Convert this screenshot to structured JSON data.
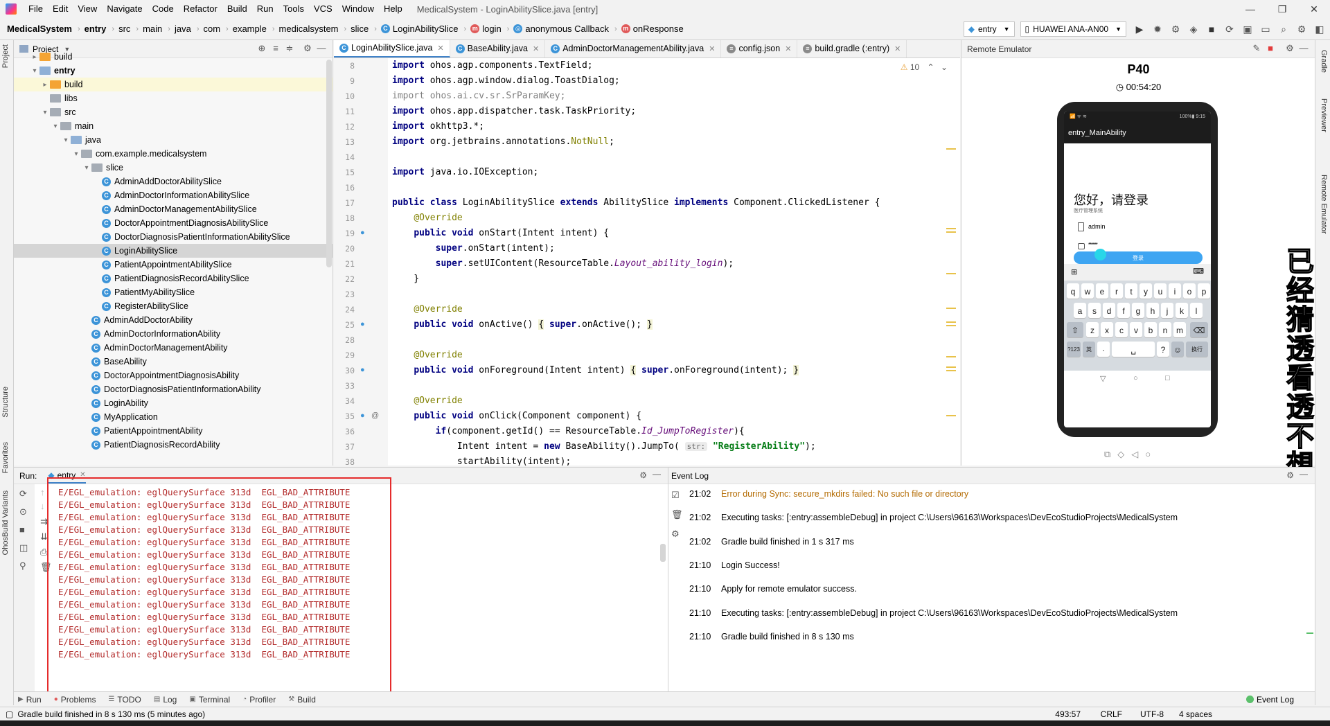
{
  "menubar": {
    "items": [
      "File",
      "Edit",
      "View",
      "Navigate",
      "Code",
      "Refactor",
      "Build",
      "Run",
      "Tools",
      "VCS",
      "Window",
      "Help"
    ],
    "title": "MedicalSystem - LoginAbilitySlice.java [entry]"
  },
  "navbar": {
    "crumbs": [
      "MedicalSystem",
      "entry",
      "src",
      "main",
      "java",
      "com",
      "example",
      "medicalsystem",
      "slice",
      "LoginAbilitySlice",
      "login",
      "anonymous Callback",
      "onResponse"
    ],
    "config": "entry",
    "device": "HUAWEI ANA-AN00"
  },
  "project": {
    "title": "Project",
    "tree": [
      {
        "label": "build",
        "depth": 1,
        "type": "folder-orange",
        "arrow": "▸"
      },
      {
        "label": "entry",
        "depth": 1,
        "type": "folder-blue",
        "arrow": "▾",
        "bold": true
      },
      {
        "label": "build",
        "depth": 2,
        "type": "folder-orange",
        "arrow": "▸",
        "hl": true
      },
      {
        "label": "libs",
        "depth": 2,
        "type": "folder-grey",
        "arrow": ""
      },
      {
        "label": "src",
        "depth": 2,
        "type": "folder-grey",
        "arrow": "▾"
      },
      {
        "label": "main",
        "depth": 3,
        "type": "folder-grey",
        "arrow": "▾"
      },
      {
        "label": "java",
        "depth": 4,
        "type": "folder-blue",
        "arrow": "▾"
      },
      {
        "label": "com.example.medicalsystem",
        "depth": 5,
        "type": "folder-grey",
        "arrow": "▾"
      },
      {
        "label": "slice",
        "depth": 6,
        "type": "folder-grey",
        "arrow": "▾"
      },
      {
        "label": "AdminAddDoctorAbilitySlice",
        "depth": 7,
        "type": "class",
        "arrow": ""
      },
      {
        "label": "AdminDoctorInformationAbilitySlice",
        "depth": 7,
        "type": "class",
        "arrow": ""
      },
      {
        "label": "AdminDoctorManagementAbilitySlice",
        "depth": 7,
        "type": "class",
        "arrow": ""
      },
      {
        "label": "DoctorAppointmentDiagnosisAbilitySlice",
        "depth": 7,
        "type": "class",
        "arrow": ""
      },
      {
        "label": "DoctorDiagnosisPatientInformationAbilitySlice",
        "depth": 7,
        "type": "class",
        "arrow": ""
      },
      {
        "label": "LoginAbilitySlice",
        "depth": 7,
        "type": "class",
        "arrow": "",
        "sel": true
      },
      {
        "label": "PatientAppointmentAbilitySlice",
        "depth": 7,
        "type": "class",
        "arrow": ""
      },
      {
        "label": "PatientDiagnosisRecordAbilitySlice",
        "depth": 7,
        "type": "class",
        "arrow": ""
      },
      {
        "label": "PatientMyAbilitySlice",
        "depth": 7,
        "type": "class",
        "arrow": ""
      },
      {
        "label": "RegisterAbilitySlice",
        "depth": 7,
        "type": "class",
        "arrow": ""
      },
      {
        "label": "AdminAddDoctorAbility",
        "depth": 6,
        "type": "class",
        "arrow": ""
      },
      {
        "label": "AdminDoctorInformationAbility",
        "depth": 6,
        "type": "class",
        "arrow": ""
      },
      {
        "label": "AdminDoctorManagementAbility",
        "depth": 6,
        "type": "class",
        "arrow": ""
      },
      {
        "label": "BaseAbility",
        "depth": 6,
        "type": "class",
        "arrow": ""
      },
      {
        "label": "DoctorAppointmentDiagnosisAbility",
        "depth": 6,
        "type": "class",
        "arrow": ""
      },
      {
        "label": "DoctorDiagnosisPatientInformationAbility",
        "depth": 6,
        "type": "class",
        "arrow": ""
      },
      {
        "label": "LoginAbility",
        "depth": 6,
        "type": "class",
        "arrow": ""
      },
      {
        "label": "MyApplication",
        "depth": 6,
        "type": "class",
        "arrow": ""
      },
      {
        "label": "PatientAppointmentAbility",
        "depth": 6,
        "type": "class",
        "arrow": ""
      },
      {
        "label": "PatientDiagnosisRecordAbility",
        "depth": 6,
        "type": "class",
        "arrow": ""
      }
    ]
  },
  "editor": {
    "tabs": [
      "LoginAbilitySlice.java",
      "BaseAbility.java",
      "AdminDoctorManagementAbility.java",
      "config.json",
      "build.gradle (:entry)"
    ],
    "warnings": "10",
    "line_numbers": [
      "8",
      "9",
      "10",
      "11",
      "12",
      "13",
      "14",
      "15",
      "16",
      "17",
      "18",
      "19",
      "20",
      "21",
      "22",
      "23",
      "24",
      "25",
      "28",
      "29",
      "30",
      "33",
      "34",
      "35",
      "36",
      "37",
      "38"
    ]
  },
  "emulator": {
    "title": "Remote Emulator",
    "device": "P40",
    "timer": "00:54:20",
    "app_title": "entry_MainAbility",
    "greeting": "您好，请登录",
    "subtitle": "医疗管理系统",
    "username": "admin",
    "password": "******",
    "login_button": "登录",
    "status_left": "📶 ᯤ ≋",
    "status_right": "100%▮ 9:15",
    "kb_row1": [
      "q",
      "w",
      "e",
      "r",
      "t",
      "y",
      "u",
      "i",
      "o",
      "p"
    ],
    "kb_row2": [
      "a",
      "s",
      "d",
      "f",
      "g",
      "h",
      "j",
      "k",
      "l"
    ],
    "kb_row3": [
      "z",
      "x",
      "c",
      "v",
      "b",
      "n",
      "m"
    ],
    "kb_123": "?123",
    "kb_lang": "英",
    "kb_enter": "换行"
  },
  "watermark": "已经猜透看透不想多说",
  "run": {
    "label": "Run:",
    "tab": "entry",
    "lines": [
      "E/EGL_emulation: eglQuerySurface 313d  EGL_BAD_ATTRIBUTE",
      "E/EGL_emulation: eglQuerySurface 313d  EGL_BAD_ATTRIBUTE",
      "E/EGL_emulation: eglQuerySurface 313d  EGL_BAD_ATTRIBUTE",
      "E/EGL_emulation: eglQuerySurface 313d  EGL_BAD_ATTRIBUTE",
      "E/EGL_emulation: eglQuerySurface 313d  EGL_BAD_ATTRIBUTE",
      "E/EGL_emulation: eglQuerySurface 313d  EGL_BAD_ATTRIBUTE",
      "E/EGL_emulation: eglQuerySurface 313d  EGL_BAD_ATTRIBUTE",
      "E/EGL_emulation: eglQuerySurface 313d  EGL_BAD_ATTRIBUTE",
      "E/EGL_emulation: eglQuerySurface 313d  EGL_BAD_ATTRIBUTE",
      "E/EGL_emulation: eglQuerySurface 313d  EGL_BAD_ATTRIBUTE",
      "E/EGL_emulation: eglQuerySurface 313d  EGL_BAD_ATTRIBUTE",
      "E/EGL_emulation: eglQuerySurface 313d  EGL_BAD_ATTRIBUTE",
      "E/EGL_emulation: eglQuerySurface 313d  EGL_BAD_ATTRIBUTE",
      "E/EGL_emulation: eglQuerySurface 313d  EGL_BAD_ATTRIBUTE"
    ]
  },
  "eventlog": {
    "title": "Event Log",
    "entries": [
      {
        "time": "21:02",
        "msg": "Error during Sync: secure_mkdirs failed: No such file or directory",
        "err": true
      },
      {
        "time": "21:02",
        "msg": "Executing tasks: [:entry:assembleDebug] in project C:\\Users\\96163\\Workspaces\\DevEcoStudioProjects\\MedicalSystem",
        "err": false
      },
      {
        "time": "21:02",
        "msg": "Gradle build finished in 1 s 317 ms",
        "err": false
      },
      {
        "time": "21:10",
        "msg": "Login Success!",
        "err": false
      },
      {
        "time": "21:10",
        "msg": "Apply for remote emulator success.",
        "err": false
      },
      {
        "time": "21:10",
        "msg": "Executing tasks: [:entry:assembleDebug] in project C:\\Users\\96163\\Workspaces\\DevEcoStudioProjects\\MedicalSystem",
        "err": false
      },
      {
        "time": "21:10",
        "msg": "Gradle build finished in 8 s 130 ms",
        "err": false
      }
    ]
  },
  "bottom_tabs": [
    "Run",
    "Problems",
    "TODO",
    "Log",
    "Terminal",
    "Profiler",
    "Build"
  ],
  "bottom_right": "Event Log",
  "status": {
    "message": "Gradle build finished in 8 s 130 ms (5 minutes ago)",
    "position": "493:57",
    "line_sep": "CRLF",
    "encoding": "UTF-8",
    "indent": "4 spaces"
  },
  "left_tools": [
    "Project",
    "Structure",
    "Favorites",
    "OhosBuild Variants"
  ],
  "right_tools": [
    "Gradle",
    "Previewer",
    "Remote Emulator"
  ]
}
